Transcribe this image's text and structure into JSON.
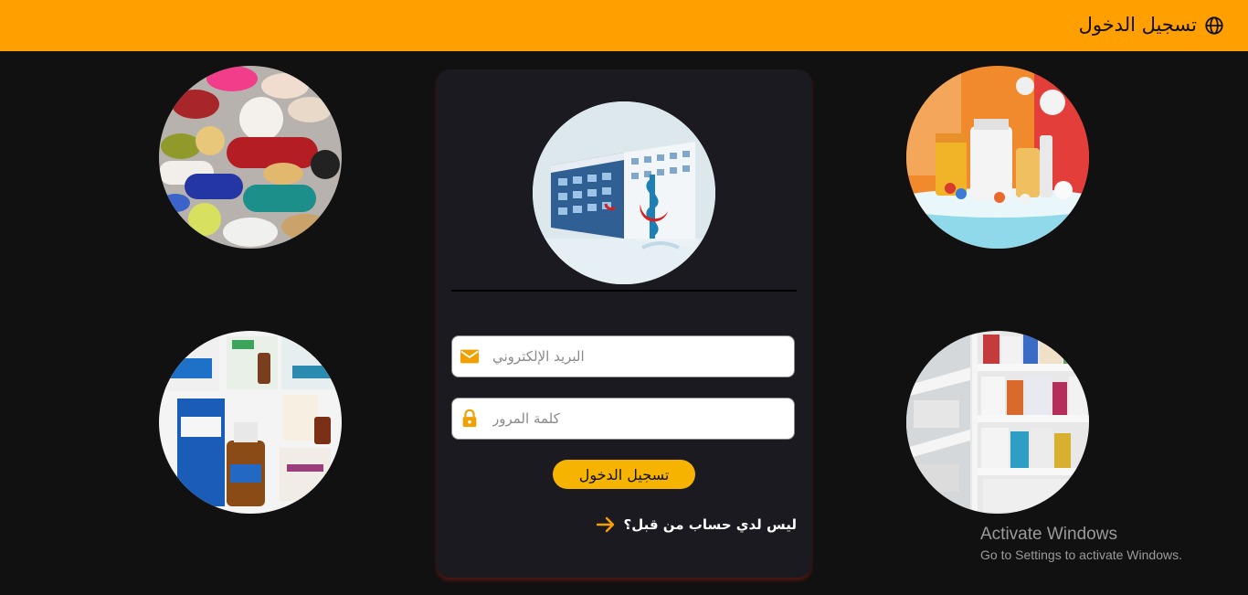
{
  "header": {
    "title": "تسجيل الدخول",
    "icon": "globe-icon",
    "background": "#ff9f00"
  },
  "images": {
    "top_left": "pills-capsules-image",
    "top_right": "pharmacy-bottles-image",
    "bottom_left": "claritine-products-image",
    "bottom_right": "pharmacy-shelves-image",
    "logo": "hospital-logo-image"
  },
  "login_form": {
    "email_placeholder": "البريد الإلكتروني",
    "password_placeholder": "كلمة المرور",
    "email_icon": "envelope-icon",
    "password_icon": "lock-icon",
    "submit_label": "تسجيل الدخول",
    "signup_text": "ليس لدي حساب من قبل؟",
    "signup_icon": "arrow-right-icon",
    "accent": "#f6b400"
  },
  "watermark": {
    "line1": "Activate Windows",
    "line2": "Go to Settings to activate Windows."
  }
}
